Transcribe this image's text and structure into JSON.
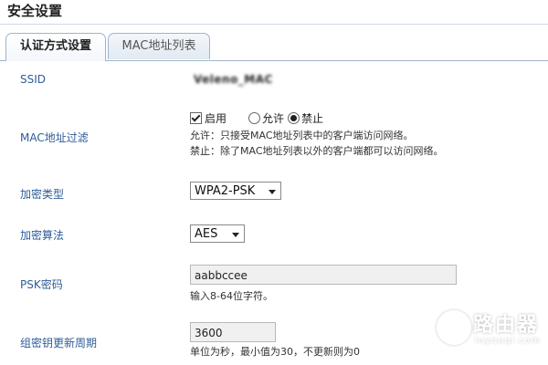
{
  "header": {
    "title": "安全设置"
  },
  "tabs": [
    {
      "label": "认证方式设置",
      "active": true
    },
    {
      "label": "MAC地址列表",
      "active": false
    }
  ],
  "form": {
    "ssid": {
      "label": "SSID",
      "value": "Veleno_MAC"
    },
    "mac_filter": {
      "label": "MAC地址过滤",
      "enable_label": "启用",
      "enable_checked": true,
      "allow_label": "允许",
      "deny_label": "禁止",
      "selected_mode": "禁止",
      "note_allow": "允许：只接受MAC地址列表中的客户端访问网络。",
      "note_deny": "禁止：除了MAC地址列表以外的客户端都可以访问网络。"
    },
    "encryption_type": {
      "label": "加密类型",
      "value": "WPA2-PSK"
    },
    "encryption_algorithm": {
      "label": "加密算法",
      "value": "AES"
    },
    "psk": {
      "label": "PSK密码",
      "value": "aabbccee",
      "hint": "输入8-64位字符。"
    },
    "group_key_period": {
      "label": "组密钥更新周期",
      "value": "3600",
      "hint": "单位为秒，最小值为30，不更新则为0"
    }
  },
  "watermark": {
    "text": "路由器",
    "url": "luyouqi.com"
  },
  "colors": {
    "label_blue": "#2f5c99",
    "tab_border": "#9fb5cc"
  }
}
